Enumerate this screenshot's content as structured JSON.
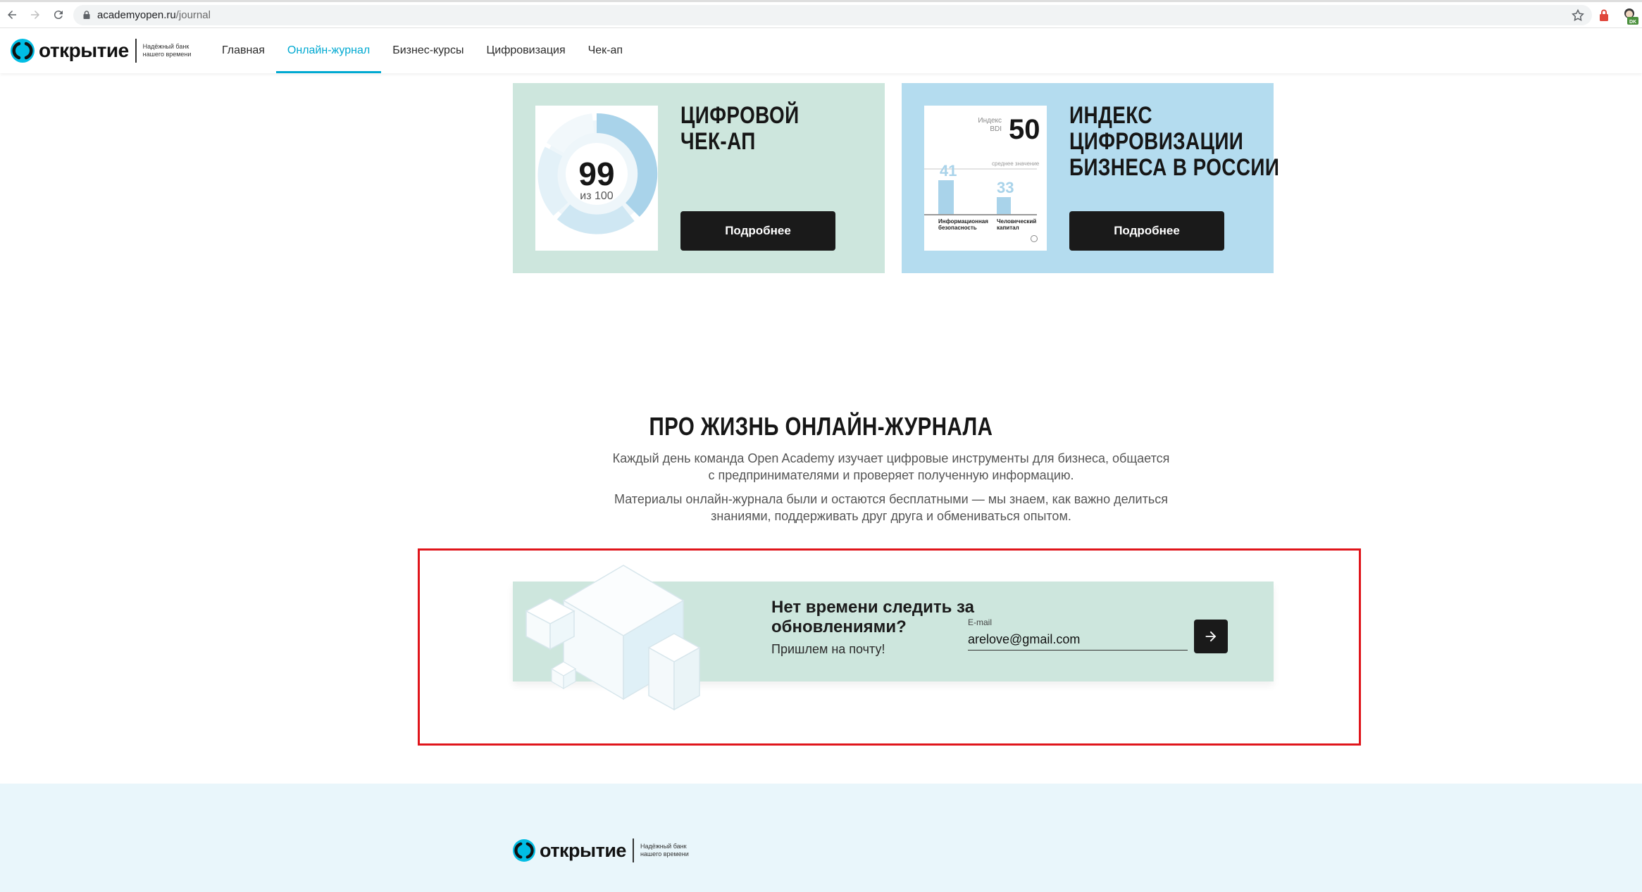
{
  "browser": {
    "url_host": "academyopen.ru",
    "url_path": "/journal",
    "profile_initials": "DK"
  },
  "header": {
    "logo_word": "открытие",
    "logo_tagline": "Надёжный банк нашего времени",
    "nav": [
      {
        "label": "Главная",
        "active": false
      },
      {
        "label": "Онлайн-журнал",
        "active": true
      },
      {
        "label": "Бизнес-курсы",
        "active": false
      },
      {
        "label": "Цифровизация",
        "active": false
      },
      {
        "label": "Чек-ап",
        "active": false
      }
    ],
    "accent_color": "#00a9d1"
  },
  "cards": {
    "checkup": {
      "title_line1": "Цифровой",
      "title_line2": "чек-ап",
      "score": "99",
      "score_sub": "из 100",
      "button": "Подробнее",
      "bg_color": "#cde6dd"
    },
    "index": {
      "title_line1": "Индекс",
      "title_line2": "цифровизации",
      "title_line3": "бизнеса в России",
      "index_label": "Индекс BDI",
      "index_value": "50",
      "avg_label": "среднее значение",
      "bar1_value": "41",
      "bar1_caption": "Информационная безопасность",
      "bar2_value": "33",
      "bar2_caption": "Человеческий капитал",
      "button": "Подробнее",
      "bg_color": "#b4dcef"
    }
  },
  "about": {
    "title": "Про жизнь онлайн-журнала",
    "p1": "Каждый день команда Open Academy изучает цифровые инструменты для бизнеса, общается с предпринимателями и проверяет полученную информацию.",
    "p2": "Материалы онлайн-журнала были и остаются бесплатными — мы знаем, как важно делиться знаниями, поддерживать друг друга и обмениваться опытом."
  },
  "subscribe": {
    "title": "Нет времени следить за обновлениями?",
    "text": "Пришлем на почту!",
    "email_label": "E-mail",
    "email_value": "arelove@gmail.com",
    "highlight_color": "#e0151b"
  },
  "footer": {
    "logo_word": "открытие",
    "logo_tagline": "Надёжный банк нашего времени"
  }
}
